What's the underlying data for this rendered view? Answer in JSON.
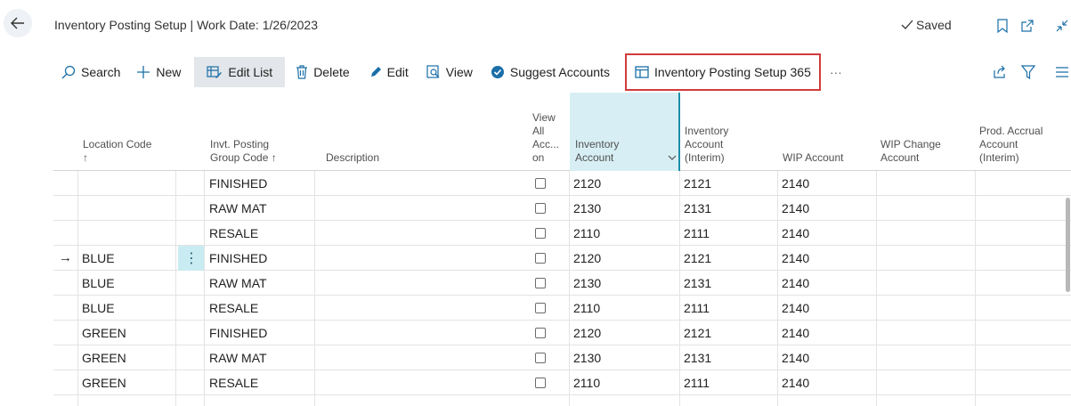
{
  "header": {
    "title": "Inventory Posting Setup | Work Date: 1/26/2023",
    "saved_label": "Saved"
  },
  "icons": {
    "back": "back-arrow-icon",
    "saved": "check-icon",
    "bookmark": "bookmark-icon",
    "open_new": "open-new-window-icon",
    "collapse": "collapse-icon",
    "search": "search-icon",
    "new": "plus-icon",
    "edit_list": "edit-list-icon",
    "delete": "trash-icon",
    "edit": "pencil-icon",
    "view": "view-icon",
    "suggest": "check-circle-icon",
    "report": "table-icon",
    "more": "ellipsis-icon",
    "share": "share-icon",
    "filter": "filter-icon",
    "list": "list-icon"
  },
  "toolbar": {
    "search": "Search",
    "new": "New",
    "edit_list": "Edit List",
    "delete": "Delete",
    "edit": "Edit",
    "view": "View",
    "suggest_accounts": "Suggest Accounts",
    "report": "Inventory Posting Setup 365",
    "more": "···"
  },
  "columns": {
    "location_code": "Location Code",
    "location_sort": "↑",
    "invt_posting_group_1": "Invt. Posting",
    "invt_posting_group_2": "Group Code ↑",
    "description": "Description",
    "view_all_1": "View",
    "view_all_2": "All",
    "view_all_3": "Acc...",
    "view_all_4": "on",
    "inventory_account_1": "Inventory",
    "inventory_account_2": "Account",
    "inventory_interim_1": "Inventory",
    "inventory_interim_2": "Account",
    "inventory_interim_3": "(Interim)",
    "wip_account": "WIP Account",
    "wip_change_1": "WIP Change",
    "wip_change_2": "Account",
    "prod_accrual_1": "Prod. Accrual",
    "prod_accrual_2": "Account",
    "prod_accrual_3": "(Interim)"
  },
  "rows": [
    {
      "location": "",
      "group": "FINISHED",
      "inventory": "2120",
      "interim": "2121",
      "wip": "2140"
    },
    {
      "location": "",
      "group": "RAW MAT",
      "inventory": "2130",
      "interim": "2131",
      "wip": "2140"
    },
    {
      "location": "",
      "group": "RESALE",
      "inventory": "2110",
      "interim": "2111",
      "wip": "2140"
    },
    {
      "location": "BLUE",
      "group": "FINISHED",
      "inventory": "2120",
      "interim": "2121",
      "wip": "2140"
    },
    {
      "location": "BLUE",
      "group": "RAW MAT",
      "inventory": "2130",
      "interim": "2131",
      "wip": "2140"
    },
    {
      "location": "BLUE",
      "group": "RESALE",
      "inventory": "2110",
      "interim": "2111",
      "wip": "2140"
    },
    {
      "location": "GREEN",
      "group": "FINISHED",
      "inventory": "2120",
      "interim": "2121",
      "wip": "2140"
    },
    {
      "location": "GREEN",
      "group": "RAW MAT",
      "inventory": "2130",
      "interim": "2131",
      "wip": "2140"
    },
    {
      "location": "GREEN",
      "group": "RESALE",
      "inventory": "2110",
      "interim": "2111",
      "wip": "2140"
    }
  ],
  "selection": {
    "row_marker": "→",
    "row_menu": "⋮"
  },
  "colors": {
    "accent": "#1a8fa8",
    "highlight_border": "#d23b3b",
    "selected_cell": "#c9ecf2"
  }
}
